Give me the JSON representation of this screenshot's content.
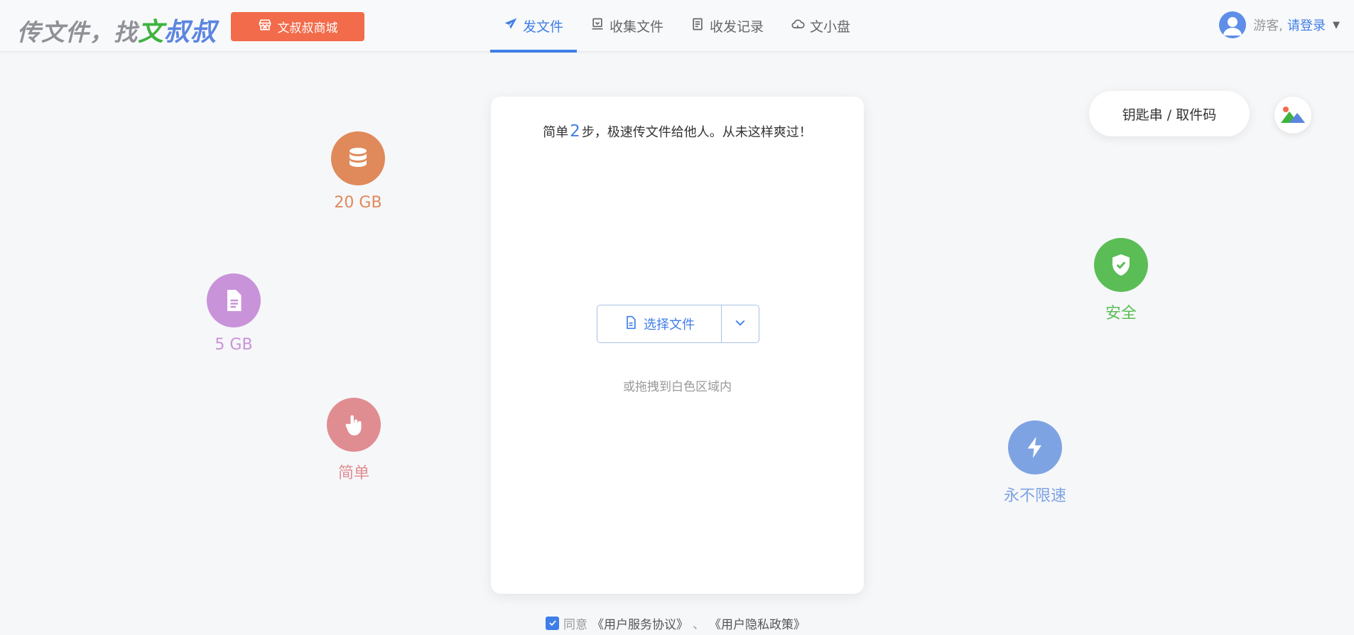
{
  "header": {
    "logo": {
      "part1": "传文件，找",
      "part2": "文",
      "part3": "叔叔"
    },
    "shop_label": "文叔叔商城",
    "nav_tabs": [
      {
        "label": "发文件",
        "icon": "send-icon",
        "active": true
      },
      {
        "label": "收集文件",
        "icon": "collect-icon",
        "active": false
      },
      {
        "label": "收发记录",
        "icon": "record-icon",
        "active": false
      },
      {
        "label": "文小盘",
        "icon": "cloud-disk-icon",
        "active": false
      }
    ],
    "user": {
      "guest": "游客,",
      "login": "请登录",
      "caret": "▼"
    }
  },
  "card": {
    "title_prefix": "简单",
    "title_num": "2",
    "title_suffix": "步，极速传文件给他人。从未这样爽过！",
    "select_label": "选择文件",
    "drag_hint": "或拖拽到白色区域内"
  },
  "features": {
    "storage_20": "20 GB",
    "file_5": "5 GB",
    "simple": "简单",
    "secure": "安全",
    "speed": "永不限速"
  },
  "right_panel": {
    "key_button": "钥匙串 / 取件码"
  },
  "agreement": {
    "agree": "同意",
    "terms": "《用户服务协议》",
    "sep": "、",
    "privacy": "《用户隐私政策》",
    "checked": true
  },
  "colors": {
    "accent": "#3f7ee8",
    "shop": "#f26b4b",
    "storage": "#e0895a",
    "file": "#c893d8",
    "simple": "#e08d92",
    "secure": "#5bbd55",
    "speed": "#7ea3e2"
  }
}
